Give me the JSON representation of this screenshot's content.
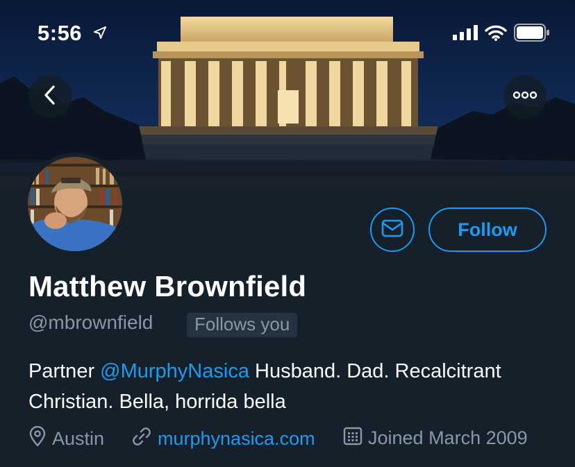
{
  "status_bar": {
    "time": "5:56"
  },
  "profile": {
    "display_name": "Matthew Brownfield",
    "handle": "@mbrownfield",
    "follows_you_badge": "Follows you",
    "bio": {
      "prefix": "Partner ",
      "mention": "@MurphyNasica",
      "suffix": " Husband. Dad. Recalcitrant Christian. Bella, horrida bella"
    },
    "location": "Austin",
    "website": "murphynasica.com",
    "joined": "Joined March 2009"
  },
  "actions": {
    "follow_label": "Follow"
  },
  "colors": {
    "background": "#15202b",
    "accent": "#1d9bf0",
    "secondary_text": "#8899a6"
  },
  "icons": {
    "location": "location-pin-icon",
    "link": "link-icon",
    "calendar": "calendar-icon",
    "message": "envelope-icon",
    "back": "chevron-left-icon",
    "more": "more-icon"
  }
}
